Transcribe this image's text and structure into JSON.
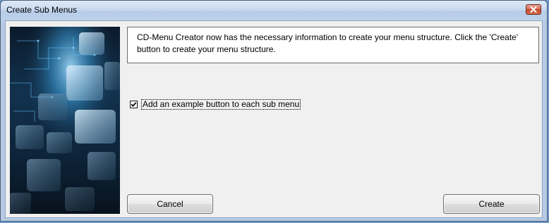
{
  "window": {
    "title": "Create Sub Menus"
  },
  "info": {
    "text": "CD-Menu Creator now has the necessary information to create your menu structure. Click the 'Create' button to create your menu structure."
  },
  "option": {
    "label": "Add an example button to each sub menu",
    "checked": true
  },
  "buttons": {
    "cancel_label": "Cancel",
    "create_label": "Create"
  },
  "icons": {
    "close": "close-icon",
    "check": "checkmark-icon"
  },
  "colors": {
    "titlebar": "#c6d8ee",
    "close_button": "#c2482f",
    "dialog_background": "#f0f0f0",
    "image_glow": "#3fa9e8"
  }
}
